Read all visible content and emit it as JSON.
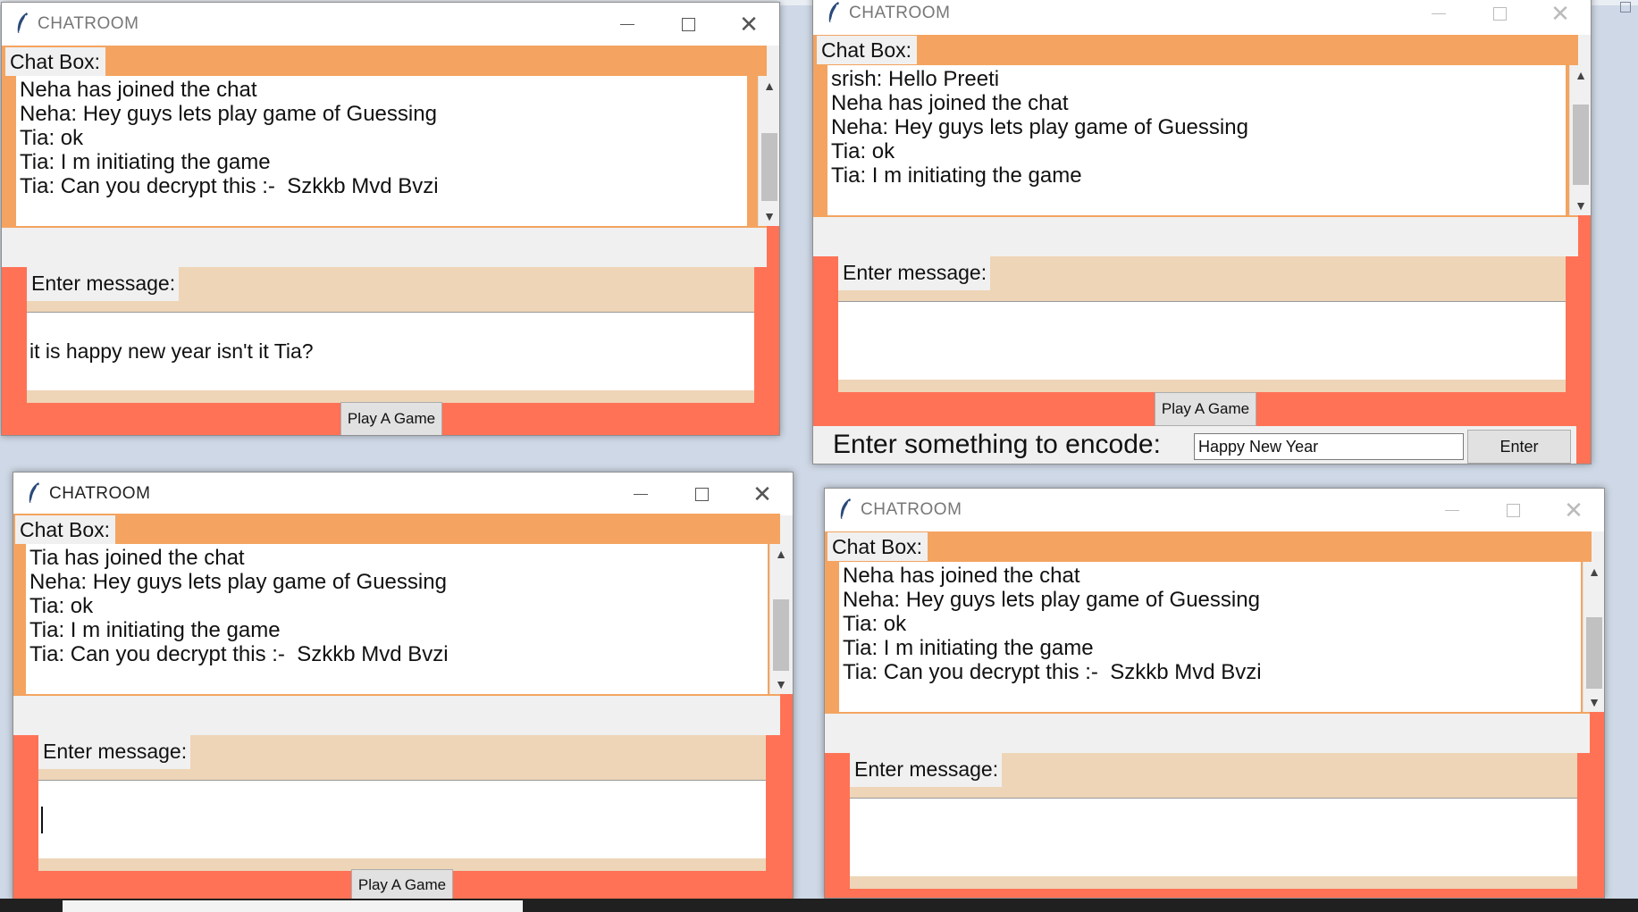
{
  "app_title": "CHATROOM",
  "chat_label": "Chat Box:",
  "message_label": "Enter message:",
  "play_button": "Play A Game",
  "windows": {
    "top_left": {
      "messages": [
        "Neha has joined the chat",
        "Neha: Hey guys lets play game of Guessing",
        "Tia: ok",
        "Tia: I m initiating the game",
        "Tia: Can you decrypt this :-  Szkkb Mvd Bvzi"
      ],
      "input_value": "it is happy new year isn't it Tia?"
    },
    "top_right": {
      "messages": [
        "srish: Hello Preeti",
        "Neha has joined the chat",
        "Neha: Hey guys lets play game of Guessing",
        "Tia: ok",
        "Tia: I m initiating the game"
      ],
      "input_value": "",
      "encode_label": "Enter something to encode:",
      "encode_value": "Happy New Year",
      "encode_button": "Enter"
    },
    "bottom_left": {
      "messages": [
        "Tia has joined the chat",
        "Neha: Hey guys lets play game of Guessing",
        "Tia: ok",
        "Tia: I m initiating the game",
        "Tia: Can you decrypt this :-  Szkkb Mvd Bvzi"
      ],
      "input_value": ""
    },
    "bottom_right": {
      "messages": [
        "Neha has joined the chat",
        "Neha: Hey guys lets play game of Guessing",
        "Tia: ok",
        "Tia: I m initiating the game",
        "Tia: Can you decrypt this :-  Szkkb Mvd Bvzi"
      ],
      "input_value": ""
    }
  },
  "icons": {
    "window_icon": "feather-icon",
    "minimize": "minimize-icon",
    "maximize": "maximize-icon",
    "close": "close-icon",
    "scroll_up": "chevron-up-icon",
    "scroll_down": "chevron-down-icon"
  },
  "colors": {
    "chat_band": "#f4a460",
    "coral_frame": "#ff7256",
    "message_band": "#eed5b7",
    "button_face": "#e1e1e1",
    "taskbar": "#202020"
  }
}
